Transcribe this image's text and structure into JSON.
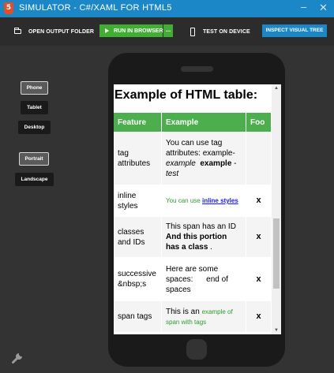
{
  "window": {
    "title": "SIMULATOR - C#/XAML FOR HTML5",
    "app_icon_glyph": "5",
    "minimize_glyph": "–",
    "close_glyph": "✕"
  },
  "toolbar": {
    "open_output_folder": "OPEN OUTPUT FOLDER",
    "run_in_browser": "RUN IN BROWSER",
    "run_more": "...",
    "test_on_device": "TEST ON DEVICE",
    "inspect_visual_tree": "INSPECT VISUAL TREE"
  },
  "device_buttons": {
    "phone": "Phone",
    "tablet": "Tablet",
    "desktop": "Desktop",
    "selected": "Phone"
  },
  "orientation_buttons": {
    "portrait": "Portrait",
    "landscape": "Landscape",
    "selected": "Portrait"
  },
  "page": {
    "heading": "Example of HTML table:",
    "columns": [
      "Feature",
      "Example",
      "Foo"
    ],
    "rows": [
      {
        "feature": "tag attributes",
        "ex_pre": "You can use tag attributes: example-",
        "ex_em": "example",
        "ex_bold": "example",
        "ex_dash": " - ",
        "ex_test": "test",
        "foo": ""
      },
      {
        "feature": "inline styles",
        "ex_pre": "You can use ",
        "ex_link": "inline styles",
        "foo": "x"
      },
      {
        "feature": "classes and IDs",
        "ex_pre": "This span has an ID ",
        "ex_bold": "And this portion has a class",
        "ex_post": " .",
        "foo": "x"
      },
      {
        "feature": "successive &nbsp;s",
        "ex_pre": "Here are some spaces:",
        "ex_post": "end of spaces",
        "foo": "x"
      },
      {
        "feature": "span tags",
        "ex_pre": "This is an ",
        "ex_green": "example of span with tags",
        "foo": "x"
      }
    ]
  },
  "scrollbar": {
    "up": "▲",
    "down": "▼"
  },
  "colors": {
    "titlebar": "#1b87c6",
    "toolbar": "#2c2c2c",
    "run_button": "#3fae33",
    "inspect_button": "#1b87c6",
    "table_header": "#4cae4c",
    "background": "#333333"
  },
  "icons": [
    "html5-icon",
    "folder-icon",
    "play-icon",
    "mobile-device-icon",
    "wrench-icon"
  ]
}
